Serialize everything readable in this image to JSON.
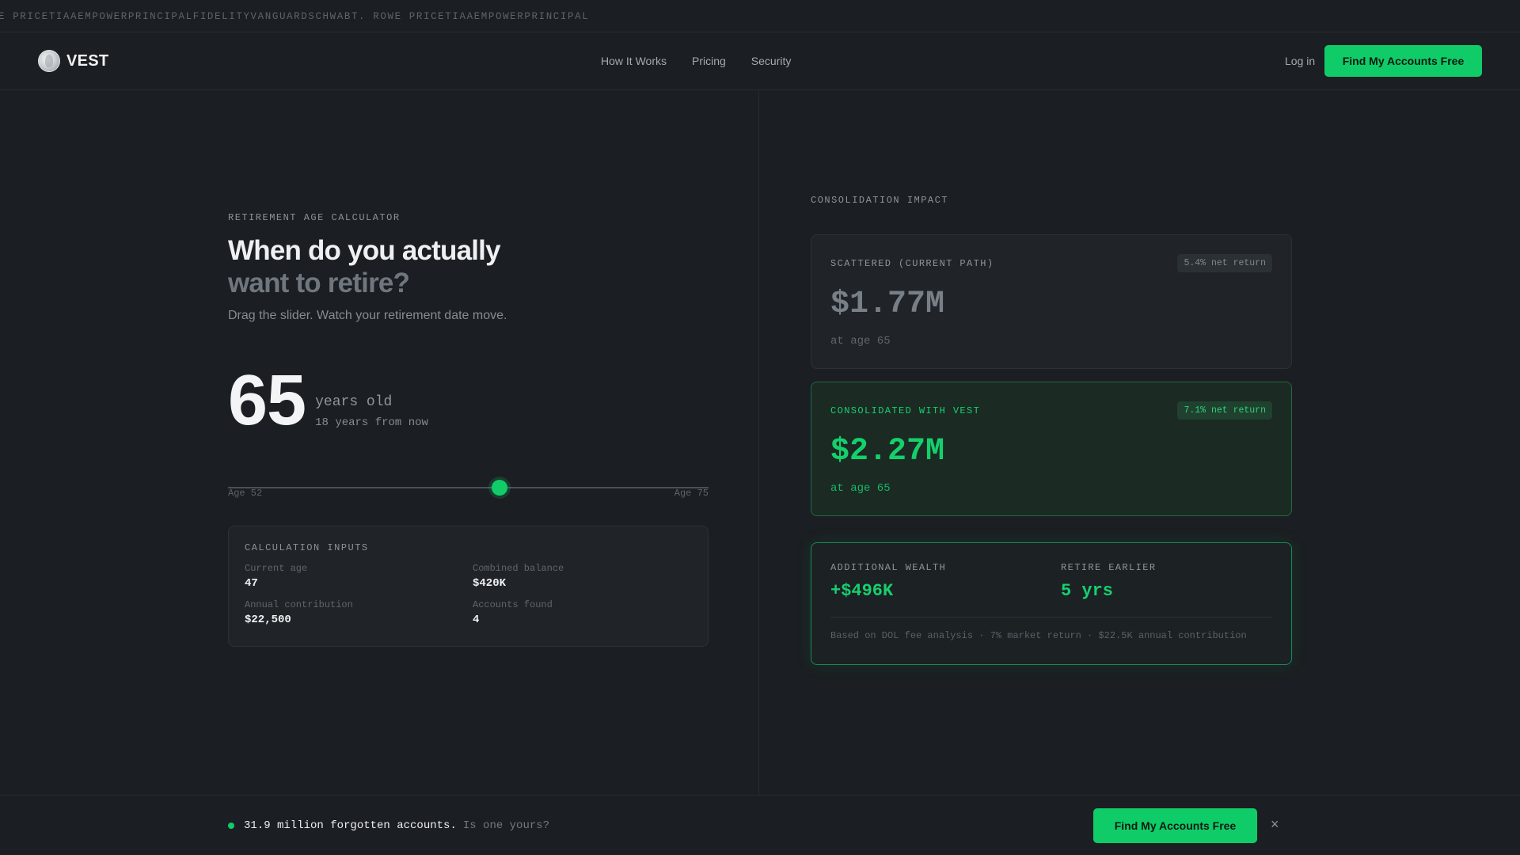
{
  "ticker": {
    "text": "E PRICETIAAEMPOWERPRINCIPALFIDELITYVANGUARDSCHWABT. ROWE PRICETIAAEMPOWERPRINCIPAL"
  },
  "header": {
    "logo_text": "VEST",
    "nav": [
      "How It Works",
      "Pricing",
      "Security"
    ],
    "login": "Log in",
    "cta": "Find My Accounts Free"
  },
  "calculator": {
    "eyebrow": "RETIREMENT AGE CALCULATOR",
    "title_line1": "When do you actually",
    "title_line2": "want to retire?",
    "subtitle": "Drag the slider. Watch your retirement date move.",
    "age": "65",
    "age_unit": "years old",
    "age_sub": "18 years from now",
    "slider": {
      "min_label": "Age 52",
      "max_label": "Age 75",
      "min": 52,
      "max": 75,
      "value": 65
    },
    "inputs": {
      "title": "CALCULATION INPUTS",
      "items": [
        {
          "label": "Current age",
          "value": "47"
        },
        {
          "label": "Combined balance",
          "value": "$420K"
        },
        {
          "label": "Annual contribution",
          "value": "$22,500"
        },
        {
          "label": "Accounts found",
          "value": "4"
        }
      ]
    }
  },
  "impact": {
    "eyebrow": "CONSOLIDATION IMPACT",
    "scattered": {
      "label": "SCATTERED (CURRENT PATH)",
      "pill": "5.4% net return",
      "amount": "$1.77M",
      "foot": "at age 65"
    },
    "consolidated": {
      "label": "CONSOLIDATED WITH VEST",
      "pill": "7.1% net return",
      "amount": "$2.27M",
      "foot": "at age 65"
    },
    "extra": {
      "wealth_label": "ADDITIONAL WEALTH",
      "wealth_value": "+$496K",
      "earlier_label": "RETIRE EARLIER",
      "earlier_value": "5 yrs",
      "note": "Based on DOL fee analysis · 7% market return · $22.5K annual contribution"
    }
  },
  "bottombar": {
    "strong": "31.9 million forgotten accounts.",
    "soft": "Is one yours?",
    "cta": "Find My Accounts Free",
    "close": "×"
  },
  "colors": {
    "accent": "#10cc68",
    "background": "#1b1e22"
  }
}
